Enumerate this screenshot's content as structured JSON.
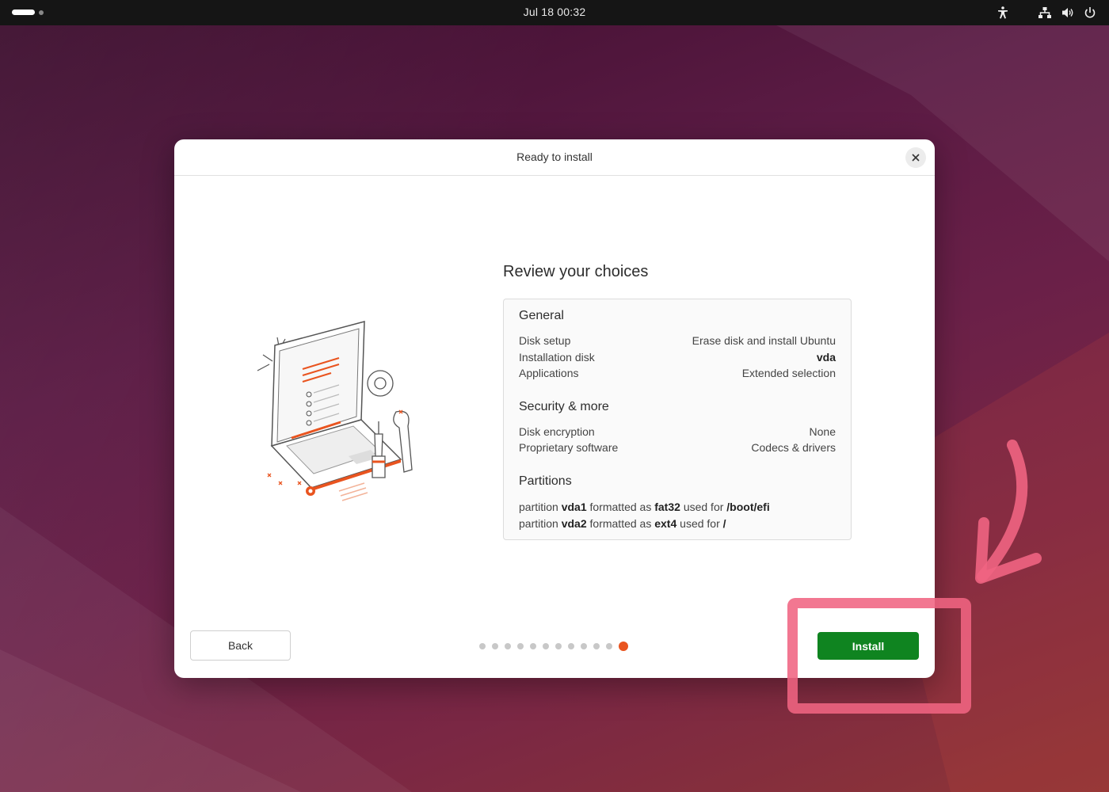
{
  "topbar": {
    "clock": "Jul 18  00:32",
    "icons": [
      "accessibility-icon",
      "network-icon",
      "volume-icon",
      "power-icon"
    ]
  },
  "dialog": {
    "title": "Ready to install",
    "heading": "Review your choices",
    "general": {
      "title": "General",
      "rows": [
        {
          "label": "Disk setup",
          "value": "Erase disk and install Ubuntu"
        },
        {
          "label": "Installation disk",
          "value": "vda"
        },
        {
          "label": "Applications",
          "value": "Extended selection"
        }
      ]
    },
    "security": {
      "title": "Security & more",
      "rows": [
        {
          "label": "Disk encryption",
          "value": "None"
        },
        {
          "label": "Proprietary software",
          "value": "Codecs & drivers"
        }
      ]
    },
    "partitions": {
      "title": "Partitions",
      "lines": [
        {
          "w1": "partition",
          "name": "vda1",
          "w2": "formatted as",
          "fs": "fat32",
          "w3": "used for",
          "mount": "/boot/efi"
        },
        {
          "w1": "partition",
          "name": "vda2",
          "w2": "formatted as",
          "fs": "ext4",
          "w3": "used for",
          "mount": "/"
        }
      ]
    },
    "back_label": "Back",
    "install_label": "Install",
    "progress": {
      "total_steps": 12,
      "current_step": 12
    }
  },
  "colors": {
    "accent": "#e9541f",
    "install_green": "#0f8420",
    "highlight_pink": "#f06482"
  }
}
